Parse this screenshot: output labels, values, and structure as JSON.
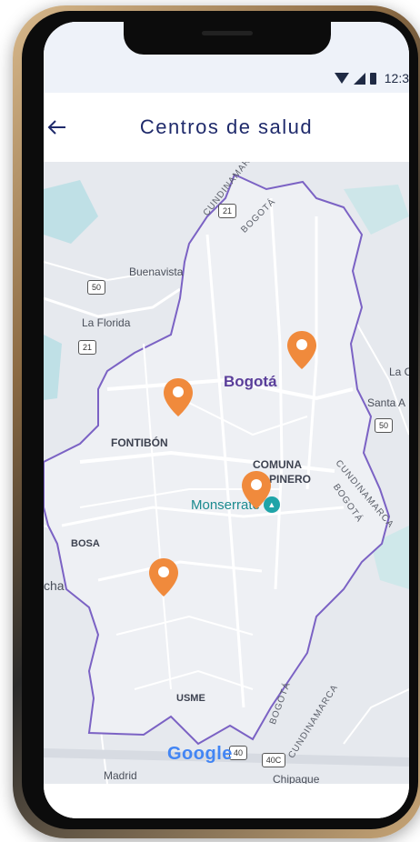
{
  "status_bar": {
    "time": "12:3"
  },
  "header": {
    "title": "Centros de salud",
    "back_icon": "arrow-left-icon"
  },
  "map": {
    "city_label": "Bogotá",
    "labels": {
      "cundinamarca_top": "CUNDINAMARCA",
      "bogota_top": "BOGOTÁ",
      "buenavista": "Buenavista",
      "la_florida": "La Florida",
      "fontibon": "FONTIBÓN",
      "comuna": "COMUNA",
      "pinero": "PINERO",
      "bosa": "BOSA",
      "cha": "cha",
      "usme": "USME",
      "bogota_right": "BOGOTÁ",
      "cundinamarca_right": "CUNDINAMARCA",
      "bogota_bottom": "BOGOTÁ",
      "cundinamarca_bottom": "CUNDINAMARCA",
      "la_c": "La C",
      "santa_a": "Santa A",
      "madrid": "Madrid",
      "chipaque": "Chipaque"
    },
    "road_shields": {
      "r21_top": "21",
      "r50_left": "50",
      "r21_left": "21",
      "r50_right": "50",
      "r40": "40",
      "r40c": "40C"
    },
    "landmark": {
      "label": "Monserrate",
      "icon": "mountain-icon"
    },
    "attribution": "Google",
    "pins_count": 4
  },
  "colors": {
    "accent": "#1f2a6b",
    "pin": "#f08a3c",
    "boundary": "#7b62c4",
    "city": "#5a3e9a",
    "landmark": "#1b8a8f"
  }
}
